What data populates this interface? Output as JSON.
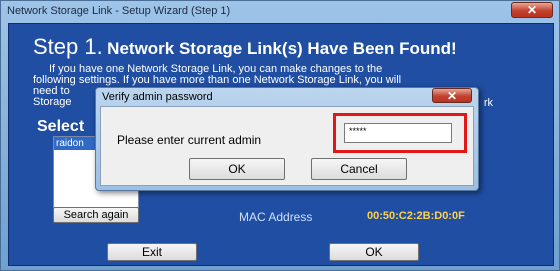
{
  "window": {
    "title": "Network Storage Link - Setup Wizard (Step 1)",
    "close_symbol": "✕"
  },
  "step": {
    "number_text": "Step 1.",
    "heading": "Network Storage Link(s) Have Been Found!"
  },
  "info_lines": {
    "line1": "If you have one Network Storage Link, you can make changes to the",
    "line2": "following settings. If you have more than one Network Storage Link, you will",
    "line3": "need to",
    "line3_right": "rk",
    "line4": "Storage"
  },
  "select_group": {
    "title": "Select",
    "list_items": [
      "raidon"
    ]
  },
  "buttons": {
    "search_again": "Search again",
    "exit": "Exit",
    "ok": "OK"
  },
  "mac": {
    "label": "MAC Address",
    "value": "00:50:C2:2B:D0:0F"
  },
  "dialog": {
    "title": "Verify admin password",
    "close_symbol": "✕",
    "prompt": "Please enter current admin",
    "password_value": "*****",
    "ok_label": "OK",
    "cancel_label": "Cancel"
  },
  "colors": {
    "client_bg": "#1f4ea3",
    "highlight": "#e01818",
    "mac_value": "#ffd24a"
  }
}
